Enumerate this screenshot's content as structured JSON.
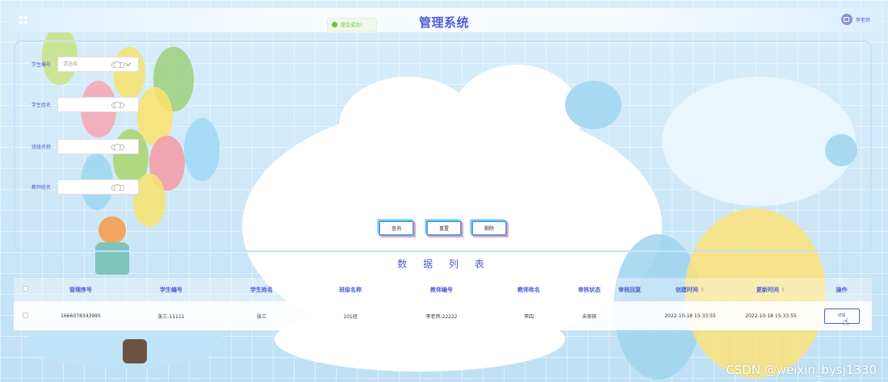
{
  "topbar": {
    "title": "管理系统",
    "toast": "提交成功!",
    "user_name": "李老师"
  },
  "search": {
    "fields": [
      {
        "label": "学生编号",
        "placeholder": "请选择",
        "type": "select"
      },
      {
        "label": "学生姓名",
        "placeholder": "",
        "type": "input"
      },
      {
        "label": "班级名称",
        "placeholder": "",
        "type": "input"
      },
      {
        "label": "教师姓名",
        "placeholder": "",
        "type": "input"
      }
    ],
    "buttons": {
      "query": "查询",
      "reset": "重置",
      "delete": "删除"
    }
  },
  "list": {
    "title": "数 据 列 表",
    "columns": [
      "管理序号",
      "学生编号",
      "学生姓名",
      "班级名称",
      "教师编号",
      "教师姓名",
      "审核状态",
      "审核回复",
      "创建时间",
      "更新时间",
      "操作"
    ],
    "sort_glyph": "⇕",
    "rows": [
      {
        "id": "1666078343995",
        "student_no": "张三-11111",
        "student_name": "张三",
        "class_name": "101班",
        "teacher_no": "李老师-22222",
        "teacher_name": "李四",
        "status": "未审核",
        "reply": "",
        "created": "2022-10-18 15:33:55",
        "updated": "2022-10-18 15:33:55",
        "action": "详情"
      }
    ]
  },
  "watermark": "CSDN @weixin_bysj1330",
  "colors": {
    "accent": "#4f5bd5",
    "button_border": "#4fa3e3",
    "success": "#67c23a"
  }
}
